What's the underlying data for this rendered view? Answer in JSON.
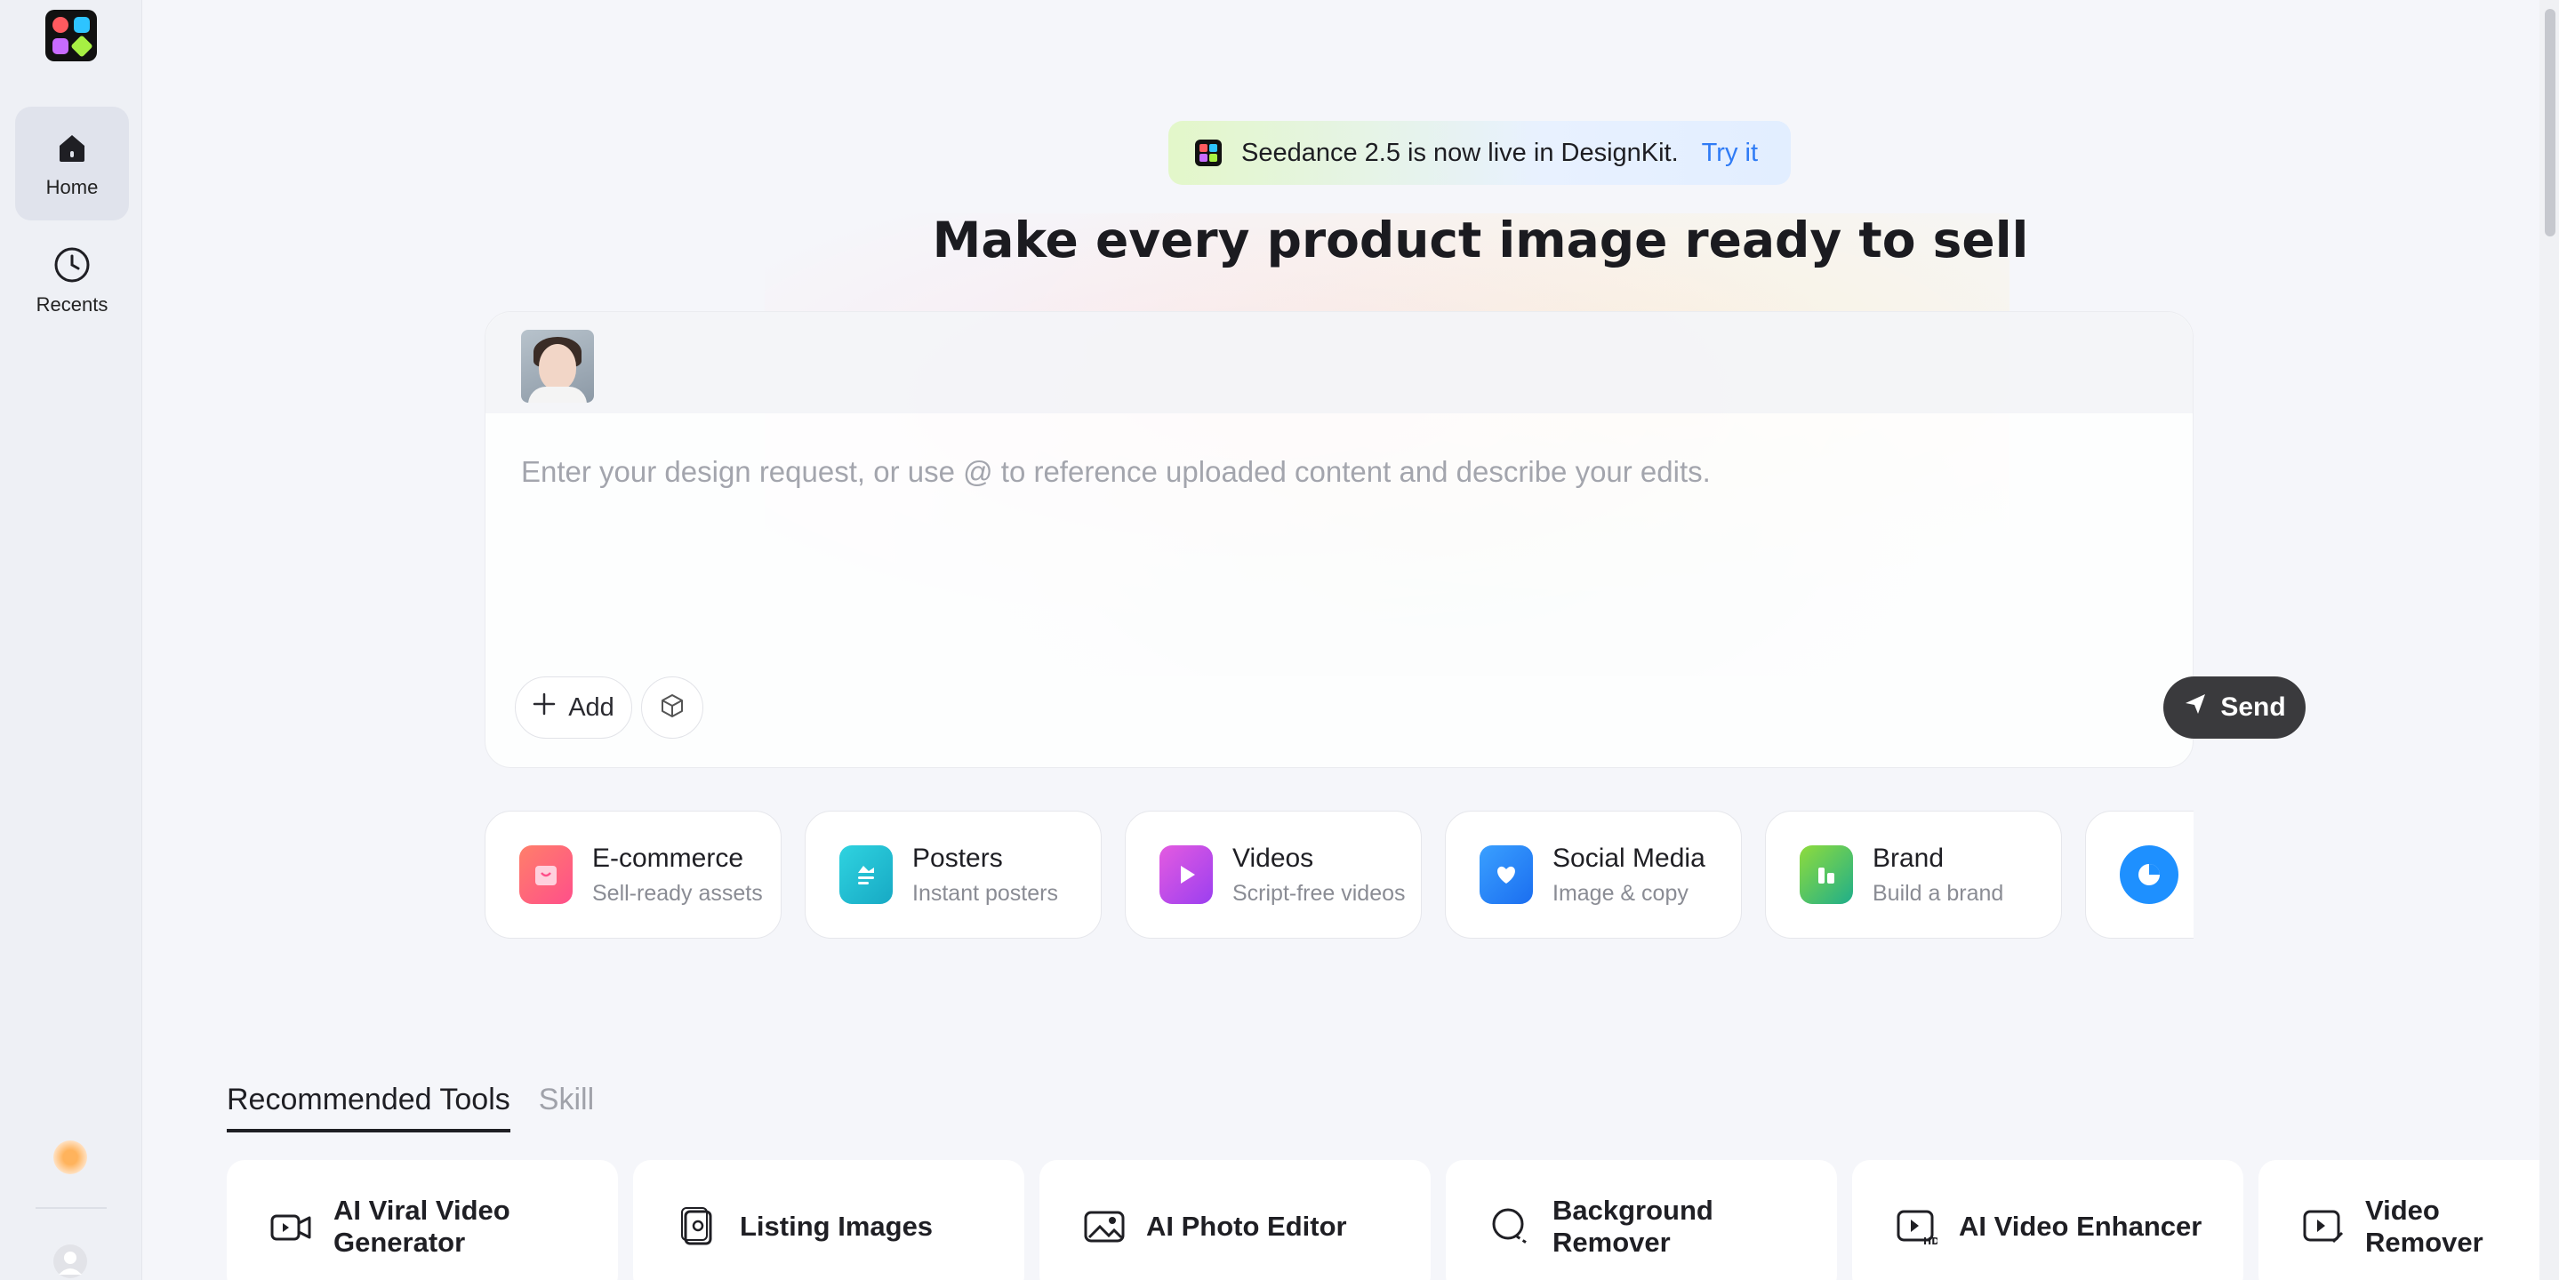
{
  "sidebar": {
    "items": [
      {
        "label": "Home",
        "icon": "home-icon",
        "active": true
      },
      {
        "label": "Recents",
        "icon": "clock-icon",
        "active": false
      }
    ]
  },
  "announcement": {
    "text": "Seedance 2.5 is now live in DesignKit.",
    "link": "Try it"
  },
  "headline": "Make every product image ready to sell",
  "composer": {
    "placeholder": "Enter your design request, or use @ to reference uploaded content and describe your edits.",
    "value": "",
    "add_label": "Add",
    "send_label": "Send"
  },
  "categories": [
    {
      "title": "E-commerce",
      "subtitle": "Sell-ready assets",
      "color": "#ff6a6a"
    },
    {
      "title": "Posters",
      "subtitle": "Instant posters",
      "color": "#1bc6d6"
    },
    {
      "title": "Videos",
      "subtitle": "Script-free videos",
      "color": "#c24ee8"
    },
    {
      "title": "Social Media",
      "subtitle": "Image & copy",
      "color": "#2a8bf2"
    },
    {
      "title": "Brand",
      "subtitle": "Build a brand",
      "color": "#3ec46d"
    },
    {
      "title": "",
      "subtitle": "",
      "color": "#1e90ff"
    }
  ],
  "tabs": [
    {
      "label": "Recommended Tools",
      "active": true
    },
    {
      "label": "Skill",
      "active": false
    }
  ],
  "tools": [
    {
      "label": "AI Viral Video Generator",
      "icon": "video-camera-icon"
    },
    {
      "label": "Listing Images",
      "icon": "listing-images-icon"
    },
    {
      "label": "AI Photo Editor",
      "icon": "photo-icon"
    },
    {
      "label": "Background Remover",
      "icon": "background-remover-icon"
    },
    {
      "label": "AI Video Enhancer",
      "icon": "hd-video-icon"
    },
    {
      "label": "Video Remover",
      "icon": "video-edit-icon"
    }
  ],
  "help_label": "?"
}
